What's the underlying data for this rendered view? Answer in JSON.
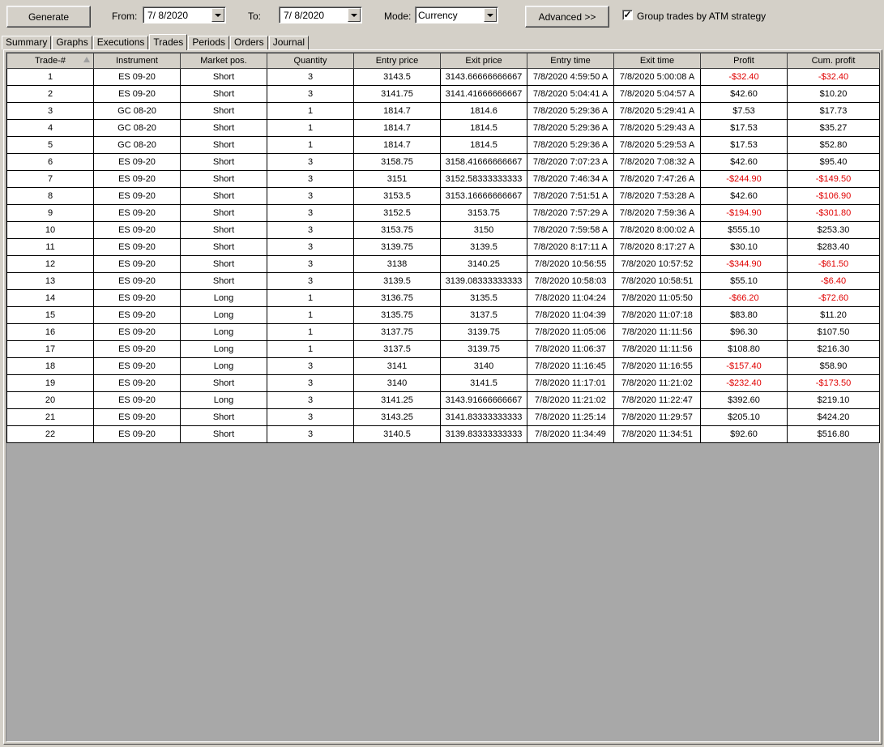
{
  "toolbar": {
    "generate_label": "Generate",
    "from_label": "From:",
    "from_value": "7/  8/2020",
    "to_label": "To:",
    "to_value": "7/  8/2020",
    "mode_label": "Mode:",
    "mode_value": "Currency",
    "advanced_label": "Advanced >>",
    "group_label": "Group trades by ATM strategy",
    "group_checked": true
  },
  "tabs": [
    {
      "label": "Summary",
      "active": false
    },
    {
      "label": "Graphs",
      "active": false
    },
    {
      "label": "Executions",
      "active": false
    },
    {
      "label": "Trades",
      "active": true
    },
    {
      "label": "Periods",
      "active": false
    },
    {
      "label": "Orders",
      "active": false
    },
    {
      "label": "Journal",
      "active": false
    }
  ],
  "table": {
    "columns": [
      "Trade-#",
      "Instrument",
      "Market pos.",
      "Quantity",
      "Entry price",
      "Exit price",
      "Entry time",
      "Exit time",
      "Profit",
      "Cum. profit"
    ],
    "sorted_column": "Trade-#",
    "rows": [
      [
        "1",
        "ES 09-20",
        "Short",
        "3",
        "3143.5",
        "3143.66666666667",
        "7/8/2020 4:59:50 A",
        "7/8/2020 5:00:08 A",
        "-$32.40",
        "-$32.40"
      ],
      [
        "2",
        "ES 09-20",
        "Short",
        "3",
        "3141.75",
        "3141.41666666667",
        "7/8/2020 5:04:41 A",
        "7/8/2020 5:04:57 A",
        "$42.60",
        "$10.20"
      ],
      [
        "3",
        "GC 08-20",
        "Short",
        "1",
        "1814.7",
        "1814.6",
        "7/8/2020 5:29:36 A",
        "7/8/2020 5:29:41 A",
        "$7.53",
        "$17.73"
      ],
      [
        "4",
        "GC 08-20",
        "Short",
        "1",
        "1814.7",
        "1814.5",
        "7/8/2020 5:29:36 A",
        "7/8/2020 5:29:43 A",
        "$17.53",
        "$35.27"
      ],
      [
        "5",
        "GC 08-20",
        "Short",
        "1",
        "1814.7",
        "1814.5",
        "7/8/2020 5:29:36 A",
        "7/8/2020 5:29:53 A",
        "$17.53",
        "$52.80"
      ],
      [
        "6",
        "ES 09-20",
        "Short",
        "3",
        "3158.75",
        "3158.41666666667",
        "7/8/2020 7:07:23 A",
        "7/8/2020 7:08:32 A",
        "$42.60",
        "$95.40"
      ],
      [
        "7",
        "ES 09-20",
        "Short",
        "3",
        "3151",
        "3152.58333333333",
        "7/8/2020 7:46:34 A",
        "7/8/2020 7:47:26 A",
        "-$244.90",
        "-$149.50"
      ],
      [
        "8",
        "ES 09-20",
        "Short",
        "3",
        "3153.5",
        "3153.16666666667",
        "7/8/2020 7:51:51 A",
        "7/8/2020 7:53:28 A",
        "$42.60",
        "-$106.90"
      ],
      [
        "9",
        "ES 09-20",
        "Short",
        "3",
        "3152.5",
        "3153.75",
        "7/8/2020 7:57:29 A",
        "7/8/2020 7:59:36 A",
        "-$194.90",
        "-$301.80"
      ],
      [
        "10",
        "ES 09-20",
        "Short",
        "3",
        "3153.75",
        "3150",
        "7/8/2020 7:59:58 A",
        "7/8/2020 8:00:02 A",
        "$555.10",
        "$253.30"
      ],
      [
        "11",
        "ES 09-20",
        "Short",
        "3",
        "3139.75",
        "3139.5",
        "7/8/2020 8:17:11 A",
        "7/8/2020 8:17:27 A",
        "$30.10",
        "$283.40"
      ],
      [
        "12",
        "ES 09-20",
        "Short",
        "3",
        "3138",
        "3140.25",
        "7/8/2020 10:56:55",
        "7/8/2020 10:57:52",
        "-$344.90",
        "-$61.50"
      ],
      [
        "13",
        "ES 09-20",
        "Short",
        "3",
        "3139.5",
        "3139.08333333333",
        "7/8/2020 10:58:03",
        "7/8/2020 10:58:51",
        "$55.10",
        "-$6.40"
      ],
      [
        "14",
        "ES 09-20",
        "Long",
        "1",
        "3136.75",
        "3135.5",
        "7/8/2020 11:04:24",
        "7/8/2020 11:05:50",
        "-$66.20",
        "-$72.60"
      ],
      [
        "15",
        "ES 09-20",
        "Long",
        "1",
        "3135.75",
        "3137.5",
        "7/8/2020 11:04:39",
        "7/8/2020 11:07:18",
        "$83.80",
        "$11.20"
      ],
      [
        "16",
        "ES 09-20",
        "Long",
        "1",
        "3137.75",
        "3139.75",
        "7/8/2020 11:05:06",
        "7/8/2020 11:11:56",
        "$96.30",
        "$107.50"
      ],
      [
        "17",
        "ES 09-20",
        "Long",
        "1",
        "3137.5",
        "3139.75",
        "7/8/2020 11:06:37",
        "7/8/2020 11:11:56",
        "$108.80",
        "$216.30"
      ],
      [
        "18",
        "ES 09-20",
        "Long",
        "3",
        "3141",
        "3140",
        "7/8/2020 11:16:45",
        "7/8/2020 11:16:55",
        "-$157.40",
        "$58.90"
      ],
      [
        "19",
        "ES 09-20",
        "Short",
        "3",
        "3140",
        "3141.5",
        "7/8/2020 11:17:01",
        "7/8/2020 11:21:02",
        "-$232.40",
        "-$173.50"
      ],
      [
        "20",
        "ES 09-20",
        "Long",
        "3",
        "3141.25",
        "3143.91666666667",
        "7/8/2020 11:21:02",
        "7/8/2020 11:22:47",
        "$392.60",
        "$219.10"
      ],
      [
        "21",
        "ES 09-20",
        "Short",
        "3",
        "3143.25",
        "3141.83333333333",
        "7/8/2020 11:25:14",
        "7/8/2020 11:29:57",
        "$205.10",
        "$424.20"
      ],
      [
        "22",
        "ES 09-20",
        "Short",
        "3",
        "3140.5",
        "3139.83333333333",
        "7/8/2020 11:34:49",
        "7/8/2020 11:34:51",
        "$92.60",
        "$516.80"
      ]
    ]
  }
}
